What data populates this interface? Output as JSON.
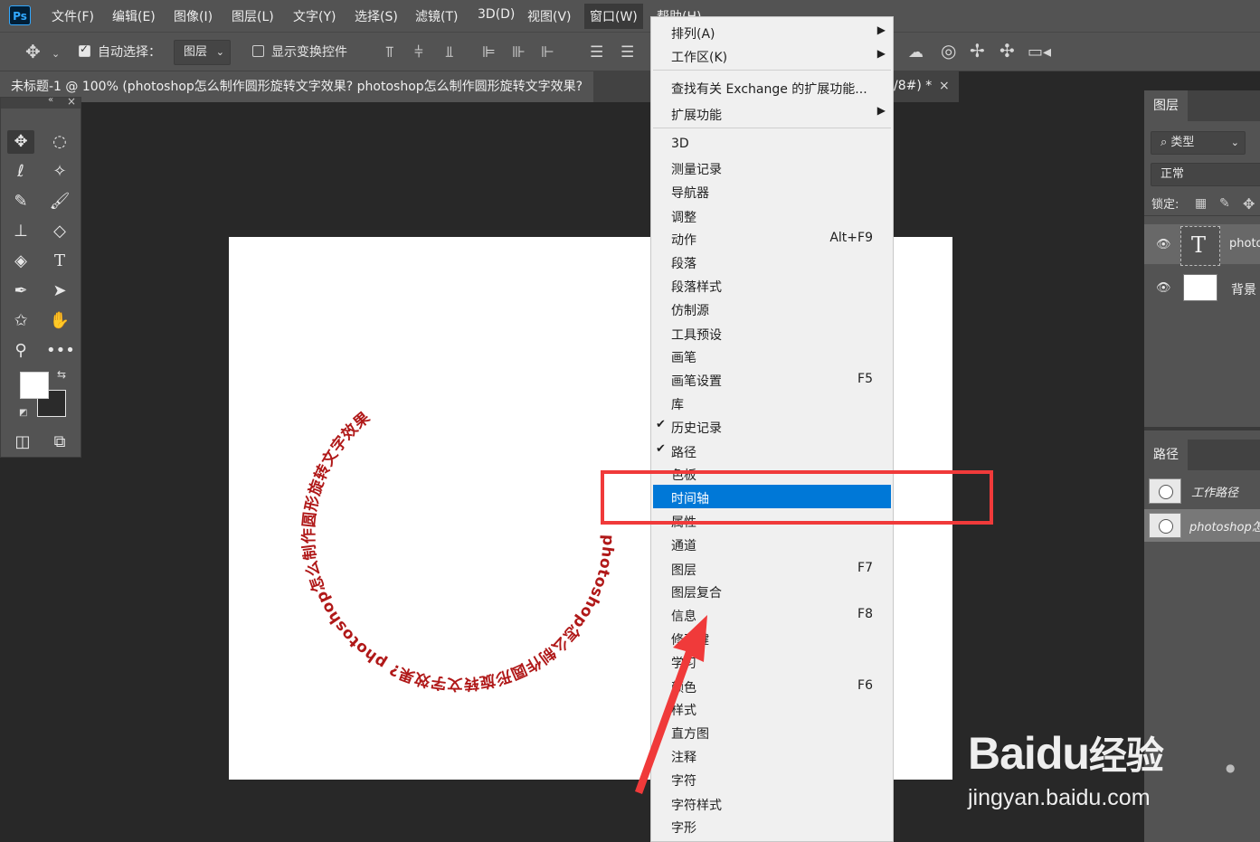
{
  "app": {
    "logo": "Ps"
  },
  "menubar": {
    "items": [
      "文件(F)",
      "编辑(E)",
      "图像(I)",
      "图层(L)",
      "文字(Y)",
      "选择(S)",
      "滤镜(T)",
      "3D(D)",
      "视图(V)",
      "窗口(W)",
      "帮助(H)"
    ]
  },
  "options_bar": {
    "auto_select_label": "自动选择：",
    "auto_select_checked": true,
    "auto_select_target": "图层",
    "show_transform_label": "显示变换控件",
    "show_transform_checked": false
  },
  "document": {
    "tab_title": "未标题-1 @ 100% (photoshop怎么制作圆形旋转文字效果? photoshop怎么制作圆形旋转文字效果?",
    "tab_suffix": "/8#) *",
    "close_symbol": "×"
  },
  "canvas": {
    "circle_text": "photoshop怎么制作圆形旋转文字效果? photoshop怎么制作圆形旋转文字效果",
    "text_color": "#b01818"
  },
  "window_menu": {
    "items": [
      {
        "label": "排列(A)",
        "submenu": true
      },
      {
        "label": "工作区(K)",
        "submenu": true
      },
      {
        "label": "查找有关 Exchange 的扩展功能..."
      },
      {
        "label": "扩展功能",
        "submenu": true
      },
      {
        "label": "3D"
      },
      {
        "label": "测量记录"
      },
      {
        "label": "导航器"
      },
      {
        "label": "调整"
      },
      {
        "label": "动作",
        "shortcut": "Alt+F9"
      },
      {
        "label": "段落"
      },
      {
        "label": "段落样式"
      },
      {
        "label": "仿制源"
      },
      {
        "label": "工具预设"
      },
      {
        "label": "画笔"
      },
      {
        "label": "画笔设置",
        "shortcut": "F5"
      },
      {
        "label": "库"
      },
      {
        "label": "历史记录",
        "checked": true
      },
      {
        "label": "路径",
        "checked": true
      },
      {
        "label": "色板"
      },
      {
        "label": "时间轴",
        "highlighted": true
      },
      {
        "label": "属性"
      },
      {
        "label": "通道"
      },
      {
        "label": "图层",
        "shortcut": "F7"
      },
      {
        "label": "图层复合"
      },
      {
        "label": "信息",
        "shortcut": "F8"
      },
      {
        "label": "修改键"
      },
      {
        "label": "学习"
      },
      {
        "label": "颜色",
        "shortcut": "F6"
      },
      {
        "label": "样式"
      },
      {
        "label": "直方图"
      },
      {
        "label": "注释"
      },
      {
        "label": "字符"
      },
      {
        "label": "字符样式"
      },
      {
        "label": "字形"
      }
    ],
    "highlight_color": "#0078d7"
  },
  "layers_panel": {
    "tab": "图层",
    "filter_label": "类型",
    "blend_mode": "正常",
    "lock_label": "锁定:",
    "layers": [
      {
        "name": "photo",
        "type": "text",
        "thumb_glyph": "T"
      },
      {
        "name": "背景",
        "type": "background"
      }
    ]
  },
  "paths_panel": {
    "tab": "路径",
    "paths": [
      "工作路径",
      "photoshop怎"
    ]
  },
  "annotation": {
    "color": "#f03a3a"
  },
  "watermark": {
    "brand": "Bai",
    "brand2": "du",
    "cn": "经验",
    "url": "jingyan.baidu.com"
  }
}
